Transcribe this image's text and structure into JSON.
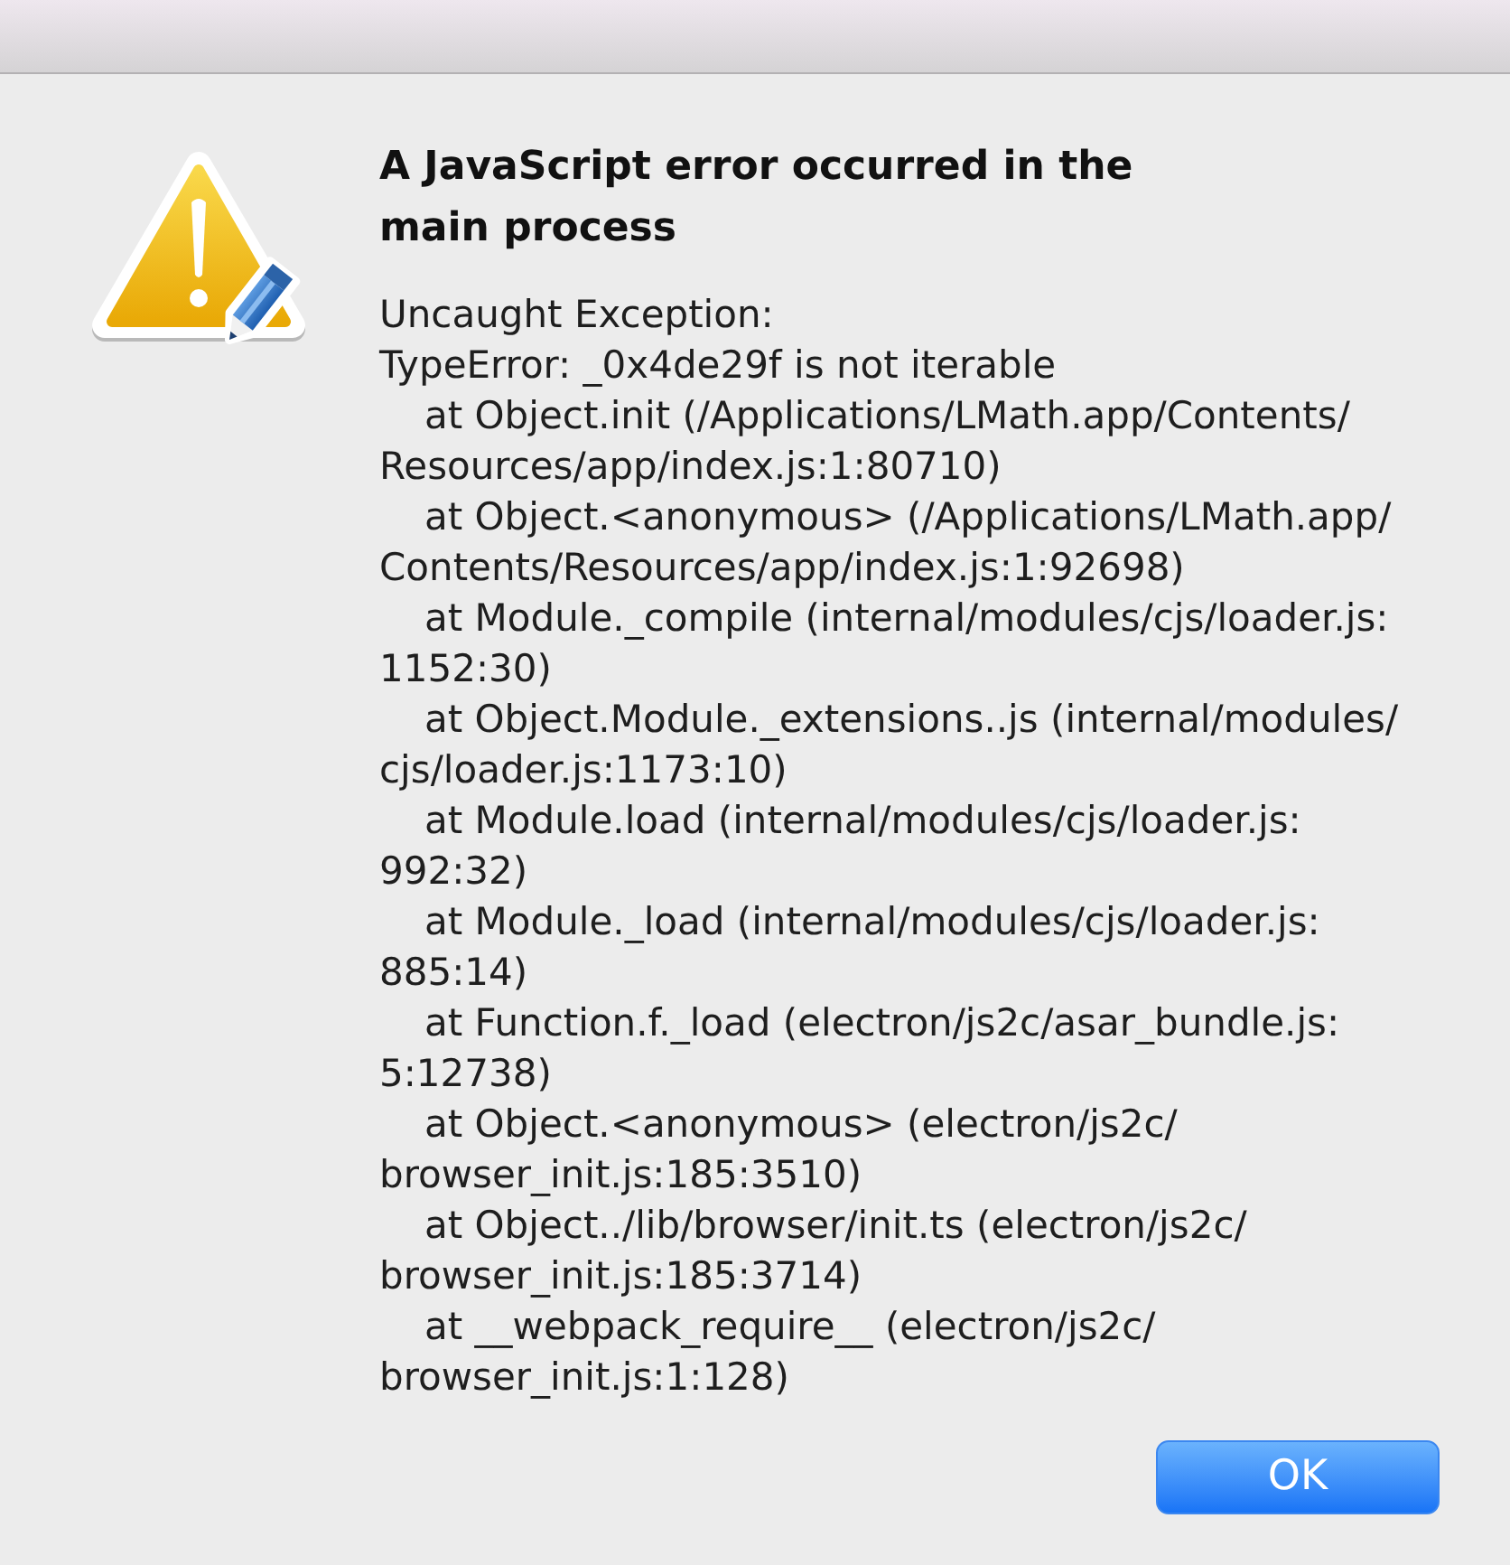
{
  "dialog": {
    "kind": "warning",
    "title": "A JavaScript error occurred in the main process",
    "message": [
      "Uncaught Exception:",
      "TypeError: _0x4de29f is not iterable"
    ],
    "stack": [
      {
        "lines": [
          "at Object.init (/Applications/LMath.app/Contents/",
          "Resources/app/index.js:1:80710)"
        ]
      },
      {
        "lines": [
          "at Object.<anonymous> (/Applications/LMath.app/",
          "Contents/Resources/app/index.js:1:92698)"
        ]
      },
      {
        "lines": [
          "at Module._compile (internal/modules/cjs/loader.js:",
          "1152:30)"
        ]
      },
      {
        "lines": [
          "at Object.Module._extensions..js (internal/modules/",
          "cjs/loader.js:1173:10)"
        ]
      },
      {
        "lines": [
          "at Module.load (internal/modules/cjs/loader.js:",
          "992:32)"
        ]
      },
      {
        "lines": [
          "at Module._load (internal/modules/cjs/loader.js:",
          "885:14)"
        ]
      },
      {
        "lines": [
          "at Function.f._load (electron/js2c/asar_bundle.js:",
          "5:12738)"
        ]
      },
      {
        "lines": [
          "at Object.<anonymous> (electron/js2c/",
          "browser_init.js:185:3510)"
        ]
      },
      {
        "lines": [
          "at Object../lib/browser/init.ts (electron/js2c/",
          "browser_init.js:185:3714)"
        ]
      },
      {
        "lines": [
          "at __webpack_require__ (electron/js2c/",
          "browser_init.js:1:128)"
        ]
      }
    ],
    "buttons": [
      {
        "label": "OK",
        "default": true
      }
    ]
  }
}
